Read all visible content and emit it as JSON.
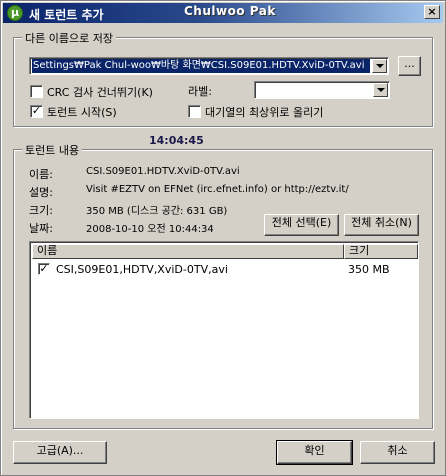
{
  "window": {
    "title": "새 토런트 추가",
    "watermark": "Chulwoo Pak",
    "close_glyph": "×",
    "app_icon_glyph": "μ"
  },
  "save_as": {
    "group_label": "다른 이름으로 저장",
    "path_value": "Settings₩Pak Chul-woo₩바탕 화면₩CSI.S09E01.HDTV.XviD-0TV.avi",
    "browse_label": "...",
    "skip_hash_label": "CRC 검사 건너뛰기(K)",
    "skip_hash_checked": false,
    "start_torrent_label": "토런트 시작(S)",
    "start_torrent_checked": true,
    "label_caption": "라벨:",
    "label_value": "",
    "top_of_queue_label": "대기열의 최상위로 올리기",
    "top_of_queue_checked": false
  },
  "timestamp_overlay": "14:04:45",
  "torrent_info": {
    "group_label": "토런트 내용",
    "name_caption": "이름:",
    "name_value": "CSI.S09E01.HDTV.XviD-0TV.avi",
    "comment_caption": "설명:",
    "comment_value": "Visit #EZTV on EFNet (irc.efnet.info) or http://eztv.it/",
    "size_caption": "크기:",
    "size_value": "350 MB (디스크 공간: 631 GB)",
    "date_caption": "날짜:",
    "date_value": "2008-10-10 오전 10:44:34",
    "select_all_label": "전체 선택(E)",
    "deselect_all_label": "전체 취소(N)"
  },
  "file_list": {
    "columns": [
      "이름",
      "크기"
    ],
    "rows": [
      {
        "name": "CSI,S09E01,HDTV,XviD-0TV,avi",
        "size": "350 MB",
        "checked": true
      }
    ]
  },
  "footer": {
    "advanced_label": "고급(A)...",
    "ok_label": "확인",
    "cancel_label": "취소"
  },
  "colors": {
    "dialog_bg": "#d4d0c8",
    "titlebar_start": "#0a246a",
    "titlebar_end": "#a6caf0",
    "selection": "#0a246a"
  }
}
